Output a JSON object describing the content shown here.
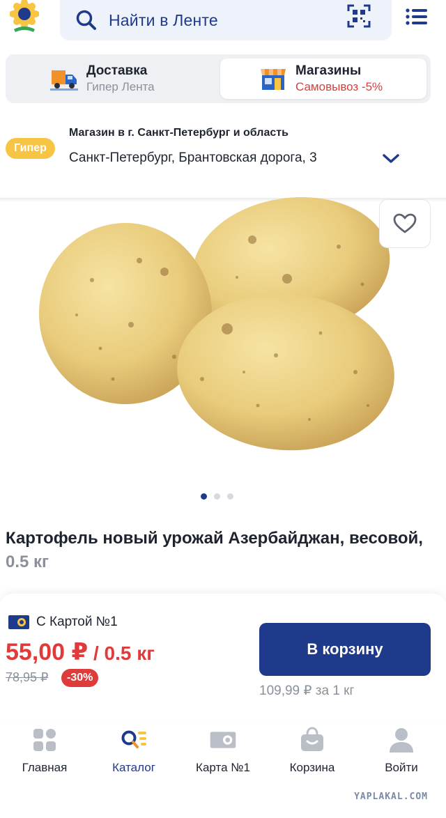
{
  "header": {
    "search_placeholder": "Найти в Ленте"
  },
  "delivery_tabs": [
    {
      "title": "Доставка",
      "subtitle": "Гипер Лента"
    },
    {
      "title": "Магазины",
      "subtitle": "Самовывоз -5%"
    }
  ],
  "store": {
    "badge": "Гипер",
    "title": "Магазин в г. Санкт-Петербург и область",
    "address": "Санкт-Петербург, Брантовская дорога, 3"
  },
  "gallery": {
    "image_alt": "potatoes",
    "dots_total": 3,
    "active_dot": 1
  },
  "product": {
    "title": "Картофель новый урожай Азербайджан, весовой,",
    "weight": "0.5 кг"
  },
  "price": {
    "card_label": "С Картой №1",
    "current": "55,00 ₽",
    "unit": " / 0.5 кг",
    "old": "78,95 ₽",
    "discount": "-30%",
    "per_kg": "109,99 ₽ за 1 кг",
    "cart_button": "В корзину"
  },
  "bottom_nav": [
    {
      "label": "Главная",
      "icon": "home-icon"
    },
    {
      "label": "Каталог",
      "icon": "catalog-icon"
    },
    {
      "label": "Карта №1",
      "icon": "card-icon"
    },
    {
      "label": "Корзина",
      "icon": "basket-icon"
    },
    {
      "label": "Войти",
      "icon": "user-icon"
    }
  ],
  "watermark": "YAPLAKAL.COM",
  "colors": {
    "brand_blue": "#1f3a8a",
    "accent_red": "#e03b3b",
    "badge_yellow": "#f7c543"
  }
}
